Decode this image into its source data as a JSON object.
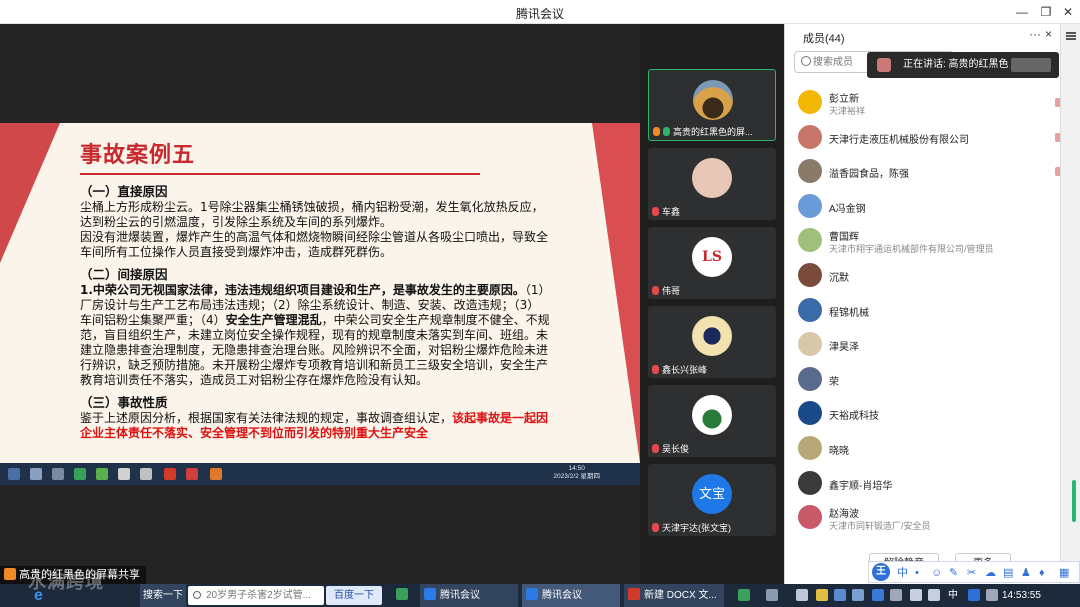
{
  "window": {
    "title": "腾讯会议"
  },
  "colors": {
    "accent_green": "#2fb36a",
    "slide_red": "#c8292e",
    "taskbar": "#1d2a3c"
  },
  "slide": {
    "title": "事故案例五",
    "s1_heading": "（一）直接原因",
    "s1_p1": "尘桶上方形成粉尘云。1号除尘器集尘桶锈蚀破损，桶内铝粉受潮，发生氧化放热反应，达到粉尘云的引燃温度，引发除尘系统及车间的系列爆炸。",
    "s1_p2": "因没有泄爆装置，爆炸产生的高温气体和燃烧物瞬间经除尘管道从各吸尘口喷出，导致全车间所有工位操作人员直接受到爆炸冲击，造成群死群伤。",
    "s2_heading": "（二）间接原因",
    "s2_lead": "1.中荣公司无视国家法律，违法违规组织项目建设和生产，是事故发生的主要原因。",
    "s2_p1": "（1）厂房设计与生产工艺布局违法违规；（2）除尘系统设计、制造、安装、改造违规；（3）车间铝粉尘集聚严重；（4）",
    "s2_bold": "安全生产管理混乱",
    "s2_p2": "，中荣公司安全生产规章制度不健全、不规范，盲目组织生产，未建立岗位安全操作规程，现有的规章制度未落实到车间、班组。未建立隐患排查治理制度，无隐患排查治理台账。风险辨识不全面，对铝粉尘爆炸危险未进行辨识，缺乏预防措施。未开展粉尘爆炸专项教育培训和新员工三级安全培训，安全生产教育培训责任不落实，造成员工对铝粉尘存在爆炸危险没有认知。",
    "s3_heading": "（三）事故性质",
    "s3_p1": "鉴于上述原因分析，根据国家有关法律法规的规定，事故调查组认定，",
    "s3_red": "该起事故是一起因企业主体责任不落实、安全管理不到位而引发的特别重大生产安全",
    "inner_clock_time": "14:50",
    "inner_clock_date": "2023/2/2 星期四"
  },
  "share_label": "高贵的红黑色的屏幕共享",
  "tiles": [
    {
      "name": "高贵的红黑色的屏...",
      "avatar_color": "#c9a15a",
      "active": true
    },
    {
      "name": "车鑫",
      "avatar_color": "#e9c7b7",
      "active": false
    },
    {
      "name": "伟哥",
      "avatar_color": "#ffffff",
      "avatar_text": "LS",
      "active": false
    },
    {
      "name": "鑫长兴张峰",
      "avatar_color": "#f3e2b0",
      "active": false
    },
    {
      "name": "吴长俊",
      "avatar_color": "#ffffff",
      "active": false
    },
    {
      "name": "天津宇达(张文宝)",
      "avatar_color": "#1e78e8",
      "avatar_text": "文宝",
      "active": false
    }
  ],
  "members_panel": {
    "title": "成员(44)",
    "more": "···",
    "close": "×",
    "search_placeholder": "搜索成员",
    "speaking": "正在讲话: 高贵的红黑色",
    "members": [
      {
        "name": "彭立新",
        "sub": "天津裕祥",
        "color": "#f2b705"
      },
      {
        "name": "天津行走液压机械股份有限公司",
        "sub": "",
        "color": "#c8756a"
      },
      {
        "name": "溢香园食品，陈强",
        "sub": "",
        "color": "#8a7a6a"
      },
      {
        "name": "A冯金钢",
        "sub": "",
        "color": "#6a9bd8"
      },
      {
        "name": "曹国辉",
        "sub": "天津市翔宇通运机械部件有限公司/管理员",
        "color": "#9fbf7a"
      },
      {
        "name": "沉默",
        "sub": "",
        "color": "#7a4a3a"
      },
      {
        "name": "程锦机械",
        "sub": "",
        "color": "#3a6aa8"
      },
      {
        "name": "津昊泽",
        "sub": "",
        "color": "#d8c8a8"
      },
      {
        "name": "荣",
        "sub": "",
        "color": "#5a6a8a"
      },
      {
        "name": "天裕成科技",
        "sub": "",
        "color": "#1a4a8a"
      },
      {
        "name": "晓晓",
        "sub": "",
        "color": "#b8a878"
      },
      {
        "name": "鑫宇顺-肖培华",
        "sub": "",
        "color": "#3a3a3a"
      },
      {
        "name": "赵海波",
        "sub": "天津市同轩锻造厂/安全员",
        "color": "#c85a6a"
      }
    ],
    "btn_mute_all": "解除静音",
    "btn_more": "更多"
  },
  "ime": {
    "logo": "王",
    "mode": "中"
  },
  "taskbar": {
    "watermark": "水满跨境",
    "ie_label": "e",
    "search_button": "搜索一下",
    "search_text": "20岁男子杀害2岁试管...",
    "baidu_button": "百度一下",
    "app1": "腾讯会议",
    "app2": "腾讯会议",
    "app3": "新建 DOCX 文...",
    "tray_lang": "中",
    "clock": "14:53:55"
  }
}
